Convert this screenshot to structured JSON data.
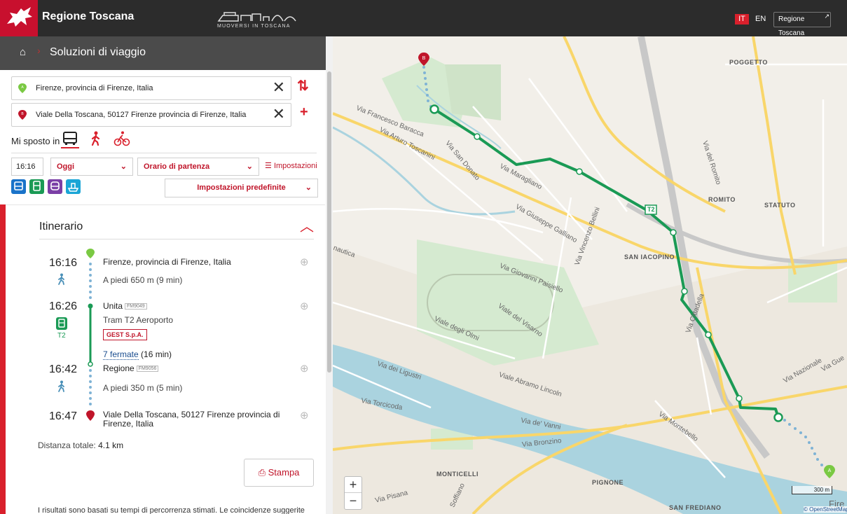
{
  "header": {
    "brand": "Regione Toscana",
    "muoversi": "MUOVERSI IN TOSCANA",
    "lang_it": "IT",
    "lang_en": "EN",
    "region_button": "Regione Toscana"
  },
  "breadcrumb": {
    "title": "Soluzioni di viaggio"
  },
  "search": {
    "origin": "Firenze, provincia di Firenze, Italia",
    "destination": "Viale Della Toscana, 50127 Firenze provincia di Firenze, Italia",
    "mode_label": "Mi sposto in",
    "time": "16:16",
    "day": "Oggi",
    "time_type": "Orario di partenza",
    "settings": "Impostazioni",
    "preset": "Impostazioni predefinite"
  },
  "itinerary": {
    "heading": "Itinerario",
    "steps": [
      {
        "time": "16:16",
        "place": "Firenze, provincia di Firenze, Italia",
        "detail": "A piedi 650 m (9 min)"
      },
      {
        "time": "16:26",
        "place": "Unita",
        "code": "FM9049",
        "detail": "Tram T2 Aeroporto",
        "line": "T2",
        "operator": "GEST S.p.A."
      },
      {
        "stops_link": "7 fermate",
        "stops_duration": "(16 min)"
      },
      {
        "time": "16:42",
        "place": "Regione",
        "code": "FM9056",
        "detail": "A piedi 350 m (5 min)"
      },
      {
        "time": "16:47",
        "place_line1": "Viale Della Toscana, 50127 Firenze provincia di",
        "place_line2": "Firenze, Italia"
      }
    ],
    "total_label": "Distanza totale:",
    "total_value": "4.1 km",
    "print": "Stampa",
    "disclaimer": "I risultati sono basati su tempi di percorrenza stimati. Le coincidenze suggerite"
  },
  "map": {
    "labels": {
      "poggetto": "POGGETTO",
      "romito": "ROMITO",
      "statuto": "STATUTO",
      "san_iacopino": "SAN IACOPINO",
      "monticelli": "MONTICELLI",
      "pignone": "PIGNONE",
      "san_frediano": "SAN FREDIANO"
    },
    "streets": {
      "baracca": "Via Francesco Baracca",
      "toscanini": "Via Arturo Toscanini",
      "san_donato": "Via San Donato",
      "maragliano": "Via Maragliano",
      "galliano": "Via Giuseppe Galliano",
      "bellini": "Via Vincenzo Bellini",
      "paisiello": "Via Giovanni Paisiello",
      "visarno": "Viale del Visarno",
      "olmi": "Viale degli Olmi",
      "ligustri": "Via dei Ligustri",
      "lincoln": "Viale Abramo Lincoln",
      "torcicoda": "Via Torcicoda",
      "vanni": "Via de' Vanni",
      "bronzino": "Via Bronzino",
      "pisana": "Via Pisana",
      "soffiano": "Soffiano",
      "montebello": "Via Montebello",
      "nazionale": "Via Nazionale",
      "cittadella": "Via Cittadella",
      "romito": "Via del Romito",
      "nautica": "nautica",
      "guelfa": "Via Gue",
      "fire": "Fire"
    },
    "tram_badge": "T2",
    "scale": "300 m",
    "attribution": "© OpenStreetMap"
  },
  "colors": {
    "accent": "#d9202c",
    "route": "#1a9a55",
    "walk": "#7fb3d5"
  }
}
